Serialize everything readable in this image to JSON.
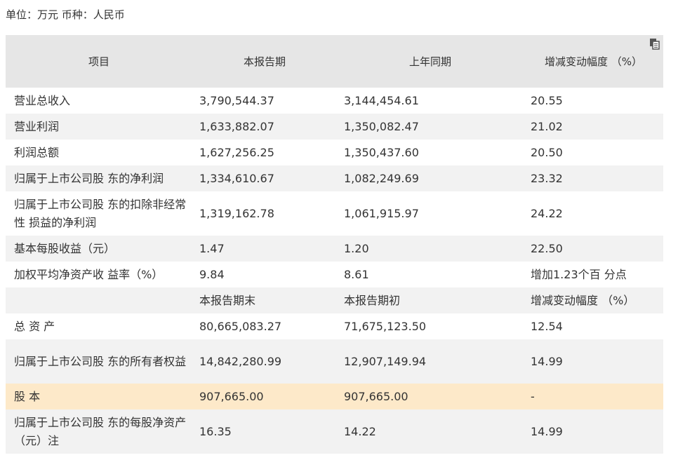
{
  "unit_label": "单位：万元 币种：人民币",
  "header": [
    "项目",
    "本报告期",
    "上年同期",
    "增减变动幅度 （%）"
  ],
  "rows": [
    {
      "item": "营业总收入",
      "current": "3,790,544.37",
      "previous": "3,144,454.61",
      "change": "20.55"
    },
    {
      "item": "营业利润",
      "current": "1,633,882.07",
      "previous": "1,350,082.47",
      "change": "21.02"
    },
    {
      "item": "利润总额",
      "current": "1,627,256.25",
      "previous": "1,350,437.60",
      "change": "20.50"
    },
    {
      "item": "归属于上市公司股 东的净利润",
      "current": "1,334,610.67",
      "previous": "1,082,249.69",
      "change": "23.32"
    },
    {
      "item": "归属于上市公司股 东的扣除非经常性 损益的净利润",
      "current": "1,319,162.78",
      "previous": "1,061,915.97",
      "change": "24.22"
    },
    {
      "item": "基本每股收益（元）",
      "current": "1.47",
      "previous": "1.20",
      "change": "22.50"
    },
    {
      "item": "加权平均净资产收 益率（%）",
      "current": "9.84",
      "previous": "8.61",
      "change": "增加1.23个百 分点"
    },
    {
      "item": "",
      "current": "本报告期末",
      "previous": "本报告期初",
      "change": "增减变动幅度 （%）"
    },
    {
      "item": "总 资 产",
      "current": "80,665,083.27",
      "previous": "71,675,123.50",
      "change": "12.54"
    },
    {
      "item": "归属于上市公司股 东的所有者权益",
      "current": "14,842,280.99",
      "previous": "12,907,149.94",
      "change": "14.99"
    },
    {
      "item": "股 本",
      "current": "907,665.00",
      "previous": "907,665.00",
      "change": "-"
    },
    {
      "item": "归属于上市公司股 东的每股净资产 （元）注",
      "current": "16.35",
      "previous": "14.22",
      "change": "14.99"
    }
  ]
}
